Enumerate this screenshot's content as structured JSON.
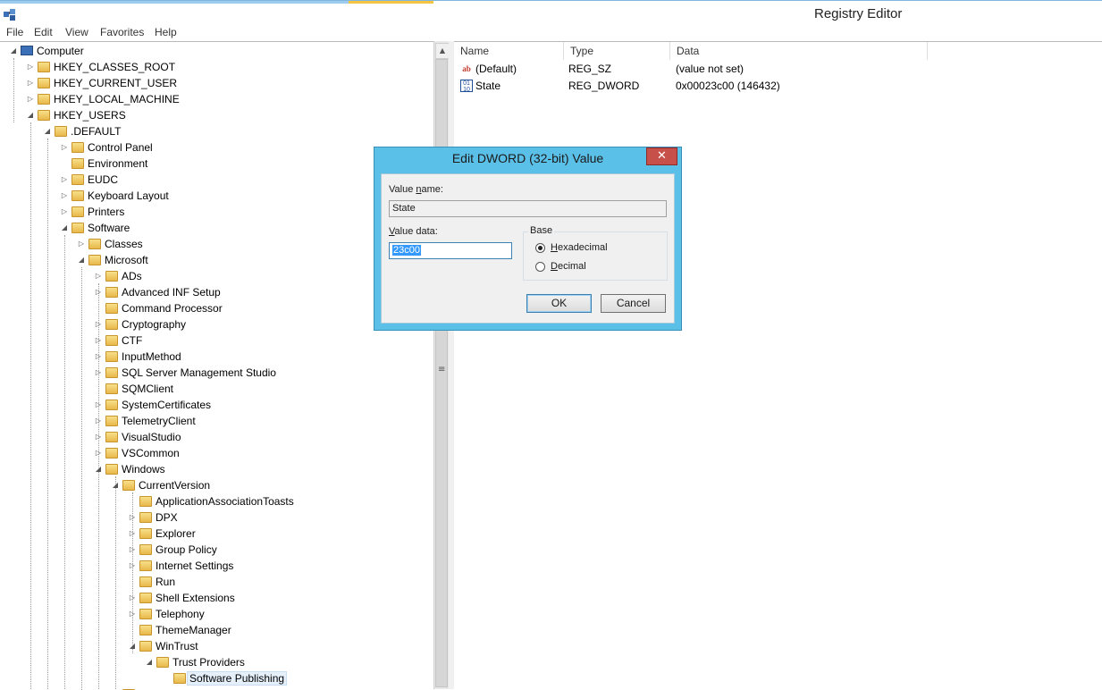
{
  "window": {
    "title": "Registry Editor",
    "icon": "regedit-icon"
  },
  "menu": [
    "File",
    "Edit",
    "View",
    "Favorites",
    "Help"
  ],
  "tree": {
    "root": "Computer",
    "hives": [
      "HKEY_CLASSES_ROOT",
      "HKEY_CURRENT_USER",
      "HKEY_LOCAL_MACHINE",
      "HKEY_USERS"
    ],
    "default_key": ".DEFAULT",
    "default_children": [
      "Control Panel",
      "Environment",
      "EUDC",
      "Keyboard Layout",
      "Printers",
      "Software"
    ],
    "software_children": [
      "Classes",
      "Microsoft"
    ],
    "microsoft_children": [
      "ADs",
      "Advanced INF Setup",
      "Command Processor",
      "Cryptography",
      "CTF",
      "InputMethod",
      "SQL Server Management Studio",
      "SQMClient",
      "SystemCertificates",
      "TelemetryClient",
      "VisualStudio",
      "VSCommon",
      "Windows"
    ],
    "windows_children": [
      "CurrentVersion"
    ],
    "currentversion_children": [
      "ApplicationAssociationToasts",
      "DPX",
      "Explorer",
      "Group Policy",
      "Internet Settings",
      "Run",
      "Shell Extensions",
      "Telephony",
      "ThemeManager",
      "WinTrust"
    ],
    "wintrust_children": [
      "Trust Providers"
    ],
    "trustproviders_children": [
      "Software Publishing"
    ]
  },
  "list": {
    "columns": [
      "Name",
      "Type",
      "Data"
    ],
    "rows": [
      {
        "name": "(Default)",
        "type": "REG_SZ",
        "data": "(value not set)",
        "icon": "string-value-icon"
      },
      {
        "name": "State",
        "type": "REG_DWORD",
        "data": "0x00023c00 (146432)",
        "icon": "binary-value-icon"
      }
    ]
  },
  "dialog": {
    "title": "Edit DWORD (32-bit) Value",
    "close": "✕",
    "value_name_label_pre": "Value ",
    "value_name_label_u": "n",
    "value_name_label_post": "ame:",
    "value_name": "State",
    "value_data_label_u": "V",
    "value_data_label_post": "alue data:",
    "value_data": "23c00",
    "base_label": "Base",
    "hex_u": "H",
    "hex_post": "exadecimal",
    "dec_u": "D",
    "dec_post": "ecimal",
    "base_selected": "Hexadecimal",
    "ok": "OK",
    "cancel": "Cancel"
  }
}
